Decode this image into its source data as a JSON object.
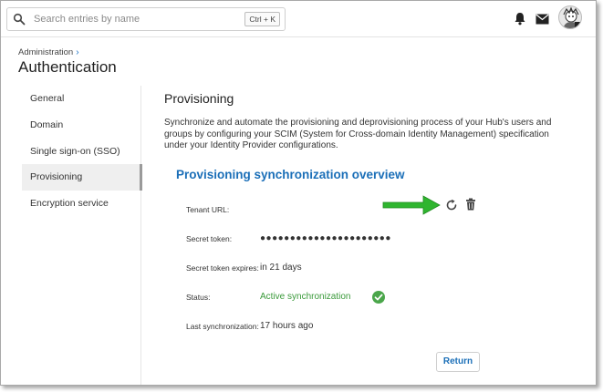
{
  "search": {
    "placeholder": "Search entries by name",
    "shortcut": "Ctrl + K"
  },
  "header": {
    "breadcrumb": "Administration",
    "title": "Authentication"
  },
  "sidebar": {
    "items": [
      {
        "label": "General"
      },
      {
        "label": "Domain"
      },
      {
        "label": "Single sign-on (SSO)"
      },
      {
        "label": "Provisioning",
        "active": true
      },
      {
        "label": "Encryption service"
      }
    ]
  },
  "main": {
    "title": "Provisioning",
    "description": "Synchronize and automate the provisioning and deprovisioning process of your Hub's users and groups by configuring your SCIM (System for Cross-domain Identity Management) specification under your Identity Provider configurations.",
    "overview_title": "Provisioning synchronization overview",
    "fields": {
      "tenant_url_label": "Tenant URL:",
      "tenant_url_value": "",
      "secret_token_label": "Secret token:",
      "secret_token_value": "●●●●●●●●●●●●●●●●●●●●●●",
      "expires_label": "Secret token expires:",
      "expires_value": "in 21 days",
      "status_label": "Status:",
      "status_value": "Active synchronization",
      "last_sync_label": "Last synchronization:",
      "last_sync_value": "17 hours ago"
    },
    "return_label": "Return"
  },
  "icons": [
    "search-icon",
    "bell-icon",
    "mail-icon",
    "avatar",
    "refresh-icon",
    "trash-icon",
    "check-circle-icon",
    "arrow-annotation"
  ],
  "colors": {
    "accent": "#1b6fb8",
    "status_ok": "#3a9a3a",
    "annotation_arrow": "#2fb52f"
  }
}
